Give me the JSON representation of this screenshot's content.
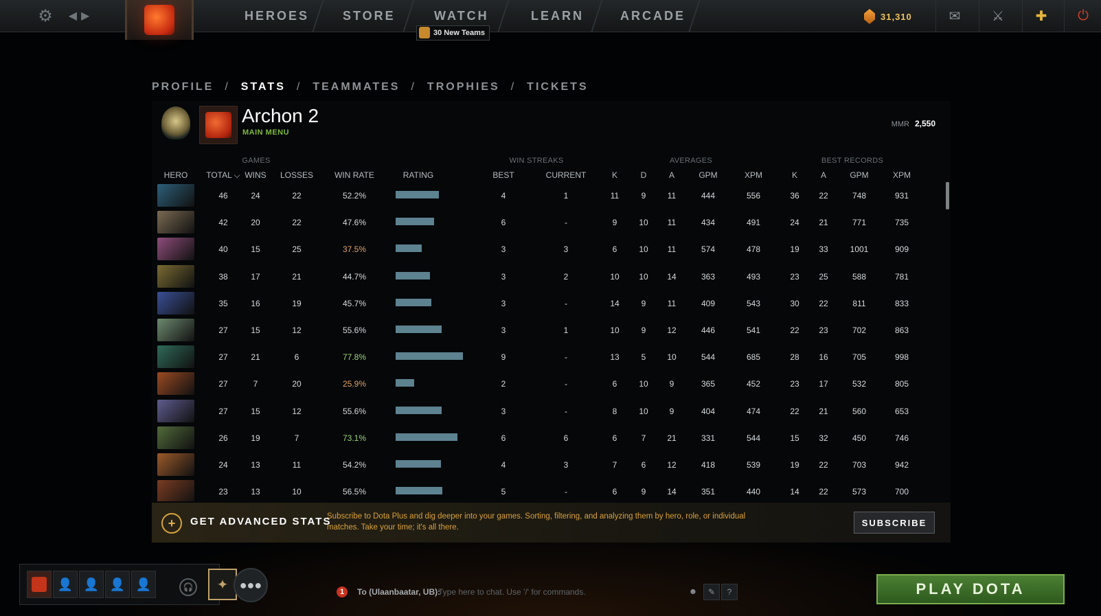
{
  "topbar": {
    "nav": [
      "HEROES",
      "STORE",
      "WATCH",
      "LEARN",
      "ARCADE"
    ],
    "watch_badge": "30 New Teams",
    "shards": "31,310",
    "icons": [
      "gear-icon",
      "back-arrow-icon",
      "forward-arrow-icon",
      "dota-logo-icon",
      "mail-icon",
      "armory-icon",
      "dota-plus-icon",
      "power-icon"
    ]
  },
  "subnav": {
    "items": [
      "PROFILE",
      "STATS",
      "TEAMMATES",
      "TROPHIES",
      "TICKETS"
    ],
    "active": "STATS",
    "sep": "/"
  },
  "profile": {
    "name": "Archon 2",
    "status": "MAIN MENU",
    "mmr_label": "MMR",
    "mmr_value": "2,550"
  },
  "table": {
    "groups": {
      "games": "GAMES",
      "win_streaks": "WIN STREAKS",
      "averages": "AVERAGES",
      "best_records": "BEST RECORDS"
    },
    "columns": {
      "hero": "HERO",
      "total": "TOTAL ⌵",
      "wins": "WINS",
      "losses": "LOSSES",
      "win_rate": "WIN RATE",
      "rating": "RATING",
      "best": "BEST",
      "current": "CURRENT",
      "k": "K",
      "d": "D",
      "a": "A",
      "gpm": "GPM",
      "xpm": "XPM",
      "bk": "K",
      "ba": "A",
      "bgpm": "GPM",
      "bxpm": "XPM"
    },
    "rows": [
      {
        "hero_color": "#2d5f79",
        "total": "46",
        "wins": "24",
        "losses": "22",
        "win_rate": "52.2%",
        "rating": 0.52,
        "best": "4",
        "current": "1",
        "k": "11",
        "d": "9",
        "a": "11",
        "gpm": "444",
        "xpm": "556",
        "bk": "36",
        "ba": "22",
        "bgpm": "748",
        "bxpm": "931"
      },
      {
        "hero_color": "#7a6a52",
        "total": "42",
        "wins": "20",
        "losses": "22",
        "win_rate": "47.6%",
        "rating": 0.46,
        "best": "6",
        "current": "-",
        "k": "9",
        "d": "10",
        "a": "11",
        "gpm": "434",
        "xpm": "491",
        "bk": "24",
        "ba": "21",
        "bgpm": "771",
        "bxpm": "735"
      },
      {
        "hero_color": "#8e4d7a",
        "total": "40",
        "wins": "15",
        "losses": "25",
        "win_rate": "37.5%",
        "rating": 0.31,
        "best": "3",
        "current": "3",
        "k": "6",
        "d": "10",
        "a": "11",
        "gpm": "574",
        "xpm": "478",
        "bk": "19",
        "ba": "33",
        "bgpm": "1001",
        "bxpm": "909"
      },
      {
        "hero_color": "#7a6b33",
        "total": "38",
        "wins": "17",
        "losses": "21",
        "win_rate": "44.7%",
        "rating": 0.41,
        "best": "3",
        "current": "2",
        "k": "10",
        "d": "10",
        "a": "14",
        "gpm": "363",
        "xpm": "493",
        "bk": "23",
        "ba": "25",
        "bgpm": "588",
        "bxpm": "781"
      },
      {
        "hero_color": "#3a4f95",
        "total": "35",
        "wins": "16",
        "losses": "19",
        "win_rate": "45.7%",
        "rating": 0.43,
        "best": "3",
        "current": "-",
        "k": "14",
        "d": "9",
        "a": "11",
        "gpm": "409",
        "xpm": "543",
        "bk": "30",
        "ba": "22",
        "bgpm": "811",
        "bxpm": "833"
      },
      {
        "hero_color": "#6d8a6f",
        "total": "27",
        "wins": "15",
        "losses": "12",
        "win_rate": "55.6%",
        "rating": 0.55,
        "best": "3",
        "current": "1",
        "k": "10",
        "d": "9",
        "a": "12",
        "gpm": "446",
        "xpm": "541",
        "bk": "22",
        "ba": "23",
        "bgpm": "702",
        "bxpm": "863"
      },
      {
        "hero_color": "#2f6a58",
        "total": "27",
        "wins": "21",
        "losses": "6",
        "win_rate": "77.8%",
        "rating": 0.8,
        "best": "9",
        "current": "-",
        "k": "13",
        "d": "5",
        "a": "10",
        "gpm": "544",
        "xpm": "685",
        "bk": "28",
        "ba": "16",
        "bgpm": "705",
        "bxpm": "998"
      },
      {
        "hero_color": "#9a4a23",
        "total": "27",
        "wins": "7",
        "losses": "20",
        "win_rate": "25.9%",
        "rating": 0.22,
        "best": "2",
        "current": "-",
        "k": "6",
        "d": "10",
        "a": "9",
        "gpm": "365",
        "xpm": "452",
        "bk": "23",
        "ba": "17",
        "bgpm": "532",
        "bxpm": "805"
      },
      {
        "hero_color": "#5f5c8e",
        "total": "27",
        "wins": "15",
        "losses": "12",
        "win_rate": "55.6%",
        "rating": 0.55,
        "best": "3",
        "current": "-",
        "k": "8",
        "d": "10",
        "a": "9",
        "gpm": "404",
        "xpm": "474",
        "bk": "22",
        "ba": "21",
        "bgpm": "560",
        "bxpm": "653"
      },
      {
        "hero_color": "#516a3a",
        "total": "26",
        "wins": "19",
        "losses": "7",
        "win_rate": "73.1%",
        "rating": 0.74,
        "best": "6",
        "current": "6",
        "k": "6",
        "d": "7",
        "a": "21",
        "gpm": "331",
        "xpm": "544",
        "bk": "15",
        "ba": "32",
        "bgpm": "450",
        "bxpm": "746"
      },
      {
        "hero_color": "#9a5a2a",
        "total": "24",
        "wins": "13",
        "losses": "11",
        "win_rate": "54.2%",
        "rating": 0.54,
        "best": "4",
        "current": "3",
        "k": "7",
        "d": "6",
        "a": "12",
        "gpm": "418",
        "xpm": "539",
        "bk": "19",
        "ba": "22",
        "bgpm": "703",
        "bxpm": "942"
      },
      {
        "hero_color": "#7a3c22",
        "total": "23",
        "wins": "13",
        "losses": "10",
        "win_rate": "56.5%",
        "rating": 0.56,
        "best": "5",
        "current": "-",
        "k": "6",
        "d": "9",
        "a": "14",
        "gpm": "351",
        "xpm": "440",
        "bk": "14",
        "ba": "22",
        "bgpm": "573",
        "bxpm": "700"
      }
    ]
  },
  "promo": {
    "title": "GET ADVANCED STATS",
    "description": "Subscribe to Dota Plus and dig deeper into your games. Sorting, filtering, and analyzing them by hero, role, or individual matches. Take your time; it's all there.",
    "button": "SUBSCRIBE"
  },
  "bottom": {
    "chat_alert": "1",
    "chat_channel": "To (Ulaanbaatar, UB):",
    "chat_placeholder": "Type here to chat. Use '/' for commands.",
    "help": "?",
    "play_button": "PLAY DOTA"
  },
  "colors": {
    "accent_green": "#7fb93a",
    "promo_gold": "#d9a23a",
    "rating_bar": "#5d8290",
    "winrate_high": "#9fd37a",
    "winrate_low": "#e0a36a"
  }
}
